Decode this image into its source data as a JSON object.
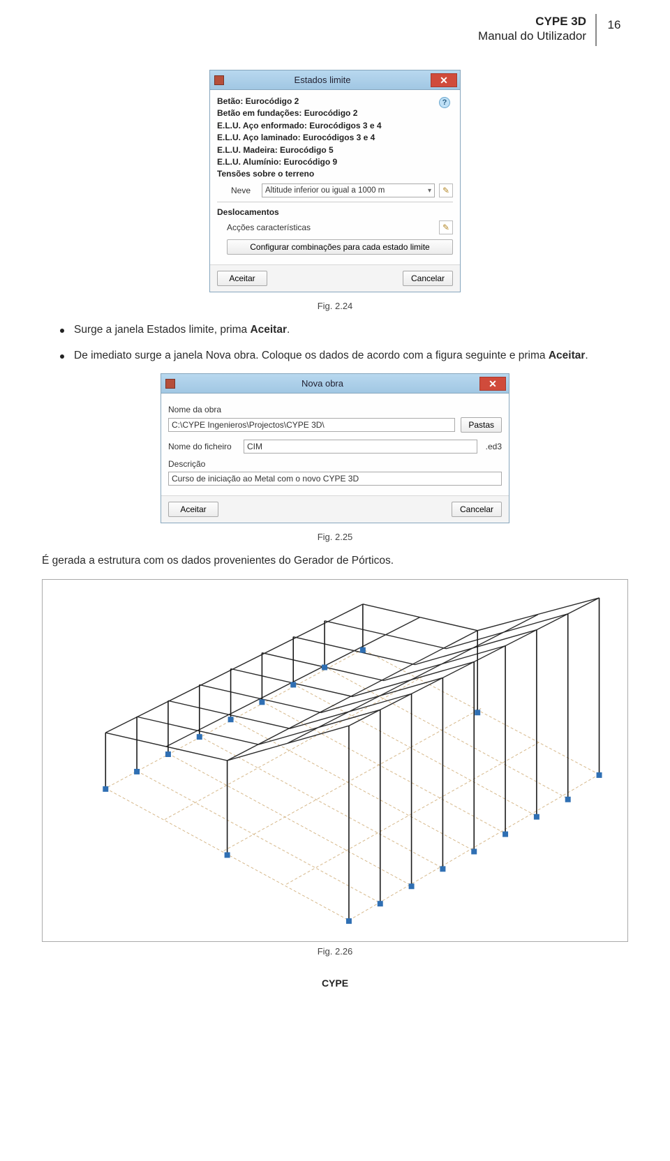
{
  "header": {
    "title1": "CYPE 3D",
    "title2": "Manual do Utilizador",
    "page_num": "16"
  },
  "dialog1": {
    "title": "Estados limite",
    "lines": {
      "betao": "Betão: Eurocódigo 2",
      "betao_fund": "Betão em fundações: Eurocódigo 2",
      "aco_enf": "E.L.U. Aço enformado: Eurocódigos 3 e 4",
      "aco_lam": "E.L.U. Aço laminado: Eurocódigos 3 e 4",
      "madeira": "E.L.U. Madeira: Eurocódigo 5",
      "aluminio": "E.L.U. Alumínio: Eurocódigo 9",
      "tensoes": "Tensões sobre o terreno"
    },
    "neve_lbl": "Neve",
    "neve_val": "Altitude inferior ou igual a 1000 m",
    "deslocamentos": "Deslocamentos",
    "accoes": "Acções características",
    "config_btn": "Configurar combinações para cada estado limite",
    "accept": "Aceitar",
    "cancel": "Cancelar"
  },
  "fig1": "Fig. 2.24",
  "bullets": {
    "b1_a": "Surge a janela Estados limite, prima ",
    "b1_b": "Aceitar",
    "b1_c": ".",
    "b2_a": "De imediato surge a janela Nova obra. Coloque os dados de acordo com a figura seguinte e prima ",
    "b2_b": "Aceitar",
    "b2_c": "."
  },
  "dialog2": {
    "title": "Nova obra",
    "nome_obra_lbl": "Nome da obra",
    "nome_obra_val": "C:\\CYPE Ingenieros\\Projectos\\CYPE 3D\\",
    "pastas_btn": "Pastas",
    "nome_ficheiro_lbl": "Nome do ficheiro",
    "nome_ficheiro_val": "CIM",
    "ext": ".ed3",
    "desc_lbl": "Descrição",
    "desc_val": "Curso de iniciação ao Metal com o novo CYPE 3D",
    "accept": "Aceitar",
    "cancel": "Cancelar"
  },
  "fig2": "Fig. 2.25",
  "para_after": "É gerada a estrutura com os dados provenientes do Gerador de Pórticos.",
  "fig3": "Fig. 2.26",
  "footer": "CYPE",
  "icons": {
    "close": "✕",
    "help": "?",
    "pencil": "✎"
  }
}
